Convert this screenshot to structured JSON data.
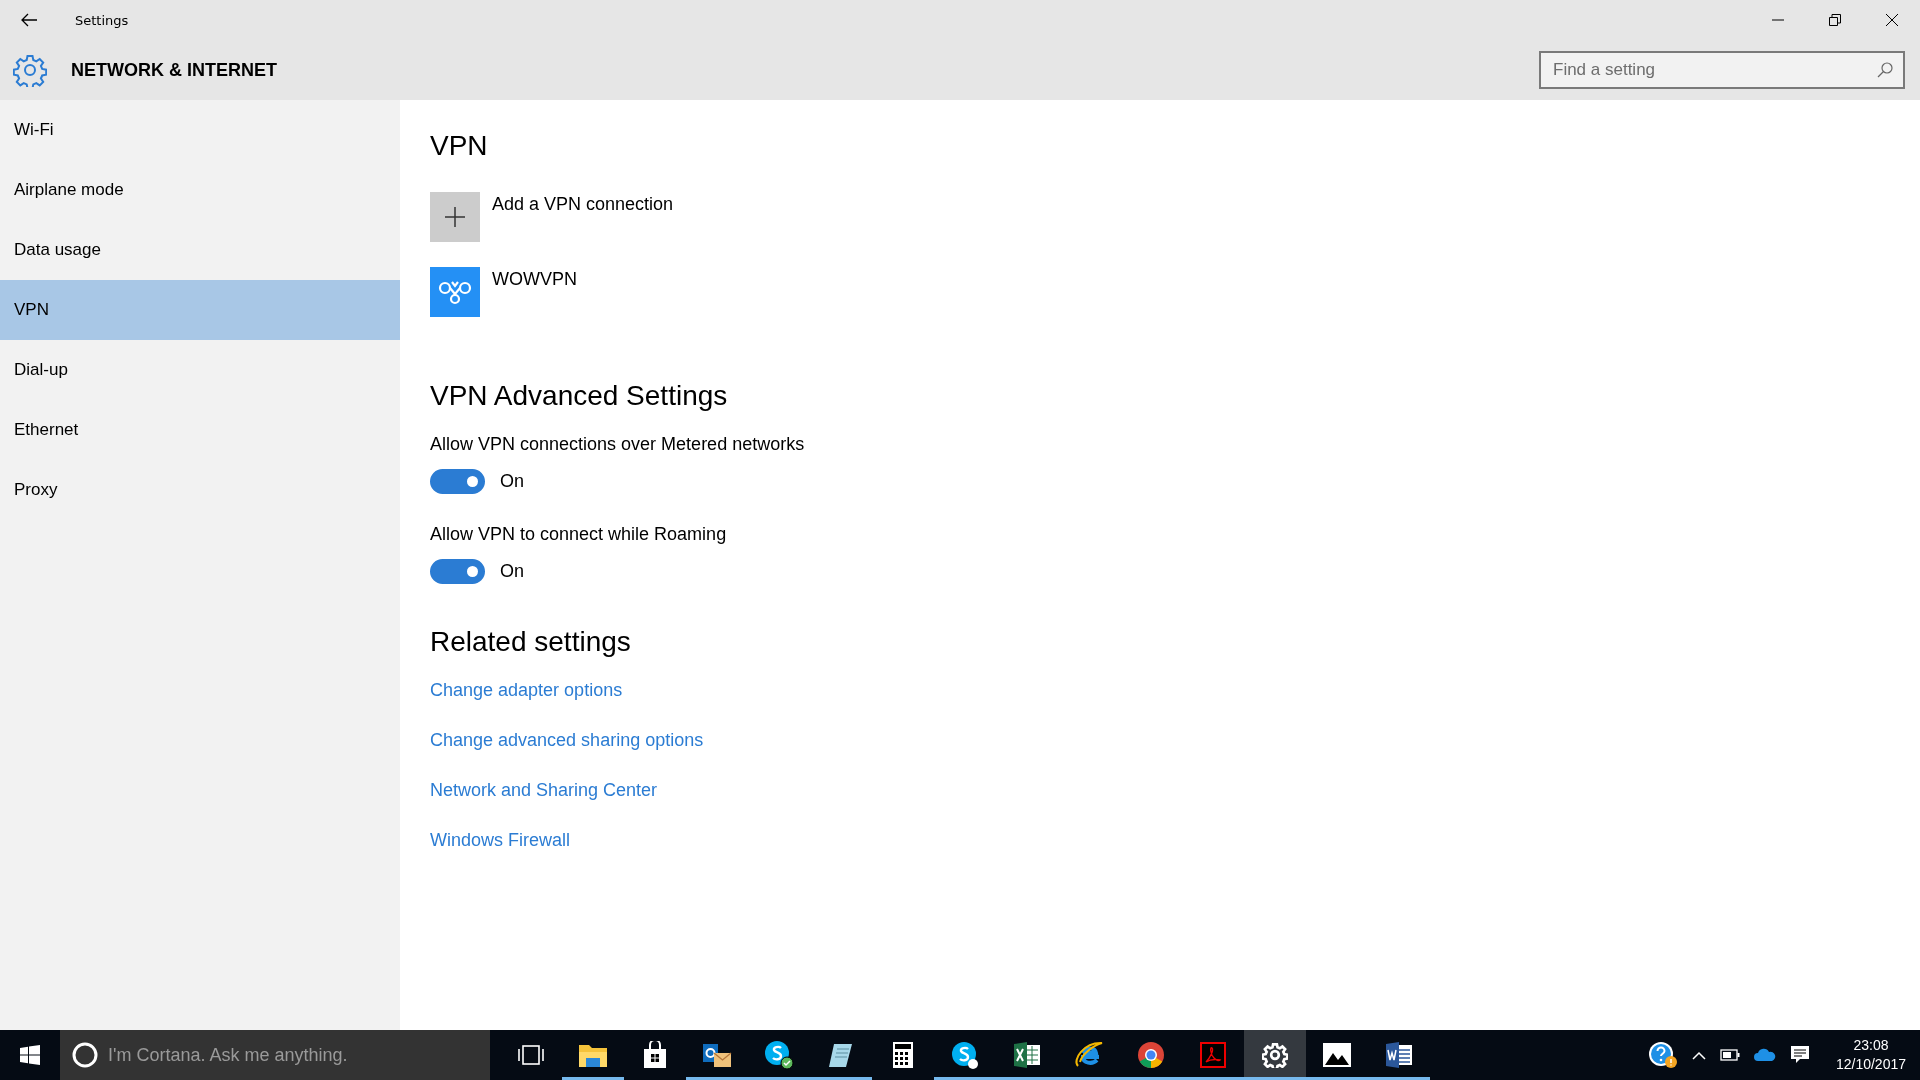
{
  "window": {
    "title": "Settings",
    "buttons": [
      {
        "kind": "minimize"
      },
      {
        "kind": "restore"
      },
      {
        "kind": "close"
      }
    ]
  },
  "header": {
    "title": "NETWORK & INTERNET"
  },
  "search": {
    "placeholder": "Find a setting"
  },
  "sidebar": {
    "items": [
      {
        "label": "Wi-Fi",
        "selected": false
      },
      {
        "label": "Airplane mode",
        "selected": false
      },
      {
        "label": "Data usage",
        "selected": false
      },
      {
        "label": "VPN",
        "selected": true
      },
      {
        "label": "Dial-up",
        "selected": false
      },
      {
        "label": "Ethernet",
        "selected": false
      },
      {
        "label": "Proxy",
        "selected": false
      }
    ]
  },
  "vpn": {
    "title": "VPN",
    "connections": [
      {
        "kind": "add",
        "label": "Add a VPN connection"
      },
      {
        "kind": "connection",
        "label": "WOWVPN"
      }
    ]
  },
  "advanced": {
    "title": "VPN Advanced Settings",
    "settings": [
      {
        "label": "Allow VPN connections over Metered networks",
        "on": true,
        "state": "On"
      },
      {
        "label": "Allow VPN to connect while Roaming",
        "on": true,
        "state": "On"
      }
    ]
  },
  "related": {
    "title": "Related settings",
    "links": [
      "Change adapter options",
      "Change advanced sharing options",
      "Network and Sharing Center",
      "Windows Firewall"
    ]
  },
  "taskbar": {
    "search_placeholder": "I'm Cortana. Ask me anything.",
    "apps": [
      {
        "kind": "taskview",
        "open": false,
        "selected": false
      },
      {
        "kind": "explorer",
        "open": true,
        "selected": false
      },
      {
        "kind": "store",
        "open": false,
        "selected": false
      },
      {
        "kind": "mail",
        "open": true,
        "selected": false
      },
      {
        "kind": "chat-status",
        "open": true,
        "selected": false
      },
      {
        "kind": "notepad",
        "open": true,
        "selected": false
      },
      {
        "kind": "calculator",
        "open": false,
        "selected": false
      },
      {
        "kind": "chat",
        "open": true,
        "selected": false
      },
      {
        "kind": "sheet",
        "open": true,
        "selected": false
      },
      {
        "kind": "ebrowser",
        "open": true,
        "selected": false
      },
      {
        "kind": "globe",
        "open": true,
        "selected": false
      },
      {
        "kind": "pdf",
        "open": true,
        "selected": false
      },
      {
        "kind": "settings",
        "open": true,
        "selected": true
      },
      {
        "kind": "photos",
        "open": true,
        "selected": false
      },
      {
        "kind": "doc",
        "open": true,
        "selected": false
      }
    ],
    "clock": {
      "time": "23:08",
      "date": "12/10/2017"
    }
  }
}
